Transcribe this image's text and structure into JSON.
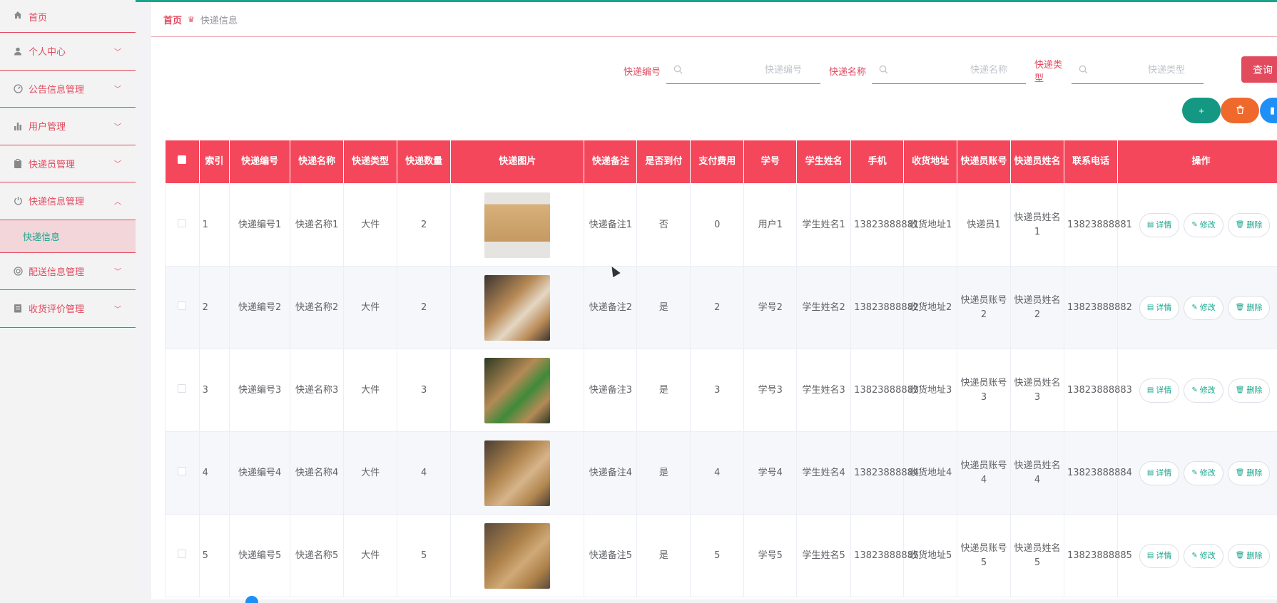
{
  "sidebar": {
    "items": [
      {
        "label": "首页",
        "icon": "home-icon",
        "name": "sidebar-item-home"
      },
      {
        "label": "个人中心",
        "icon": "user-icon",
        "name": "sidebar-item-personal"
      },
      {
        "label": "公告信息管理",
        "icon": "gauge-icon",
        "name": "sidebar-item-notice"
      },
      {
        "label": "用户管理",
        "icon": "bar-chart-icon",
        "name": "sidebar-item-users"
      },
      {
        "label": "快递员管理",
        "icon": "clipboard-icon",
        "name": "sidebar-item-courier"
      },
      {
        "label": "快递信息管理",
        "icon": "power-icon",
        "name": "sidebar-item-express"
      },
      {
        "label": "快递信息",
        "name": "sidebar-subitem-express-info"
      },
      {
        "label": "配送信息管理",
        "icon": "lifebuoy-icon",
        "name": "sidebar-item-delivery"
      },
      {
        "label": "收货评价管理",
        "icon": "document-icon",
        "name": "sidebar-item-review"
      }
    ]
  },
  "breadcrumb": {
    "home": "首页",
    "current": "快递信息"
  },
  "search": {
    "f1_label": "快递编号",
    "f1_placeholder": "快递编号",
    "f2_label": "快递名称",
    "f2_placeholder": "快递名称",
    "f3_label": "快递类型",
    "f3_placeholder": "快递类型",
    "query": "查询"
  },
  "actions": {
    "add": "+",
    "delete": "🗑",
    "chart": "▮"
  },
  "table": {
    "headers": [
      "索引",
      "快递编号",
      "快递名称",
      "快递类型",
      "快递数量",
      "快递图片",
      "快递备注",
      "是否到付",
      "支付费用",
      "学号",
      "学生姓名",
      "手机",
      "收货地址",
      "快递员账号",
      "快递员姓名",
      "联系电话",
      "操作"
    ],
    "ops": {
      "detail": "详情",
      "edit": "修改",
      "delete": "删除"
    },
    "rows": [
      [
        "1",
        "快递编号1",
        "快递名称1",
        "大件",
        "2",
        "",
        "快递备注1",
        "否",
        "0",
        "用户1",
        "学生姓名1",
        "13823888881",
        "收货地址1",
        "快递员1",
        "快递员姓名1",
        "13823888881"
      ],
      [
        "2",
        "快递编号2",
        "快递名称2",
        "大件",
        "2",
        "",
        "快递备注2",
        "是",
        "2",
        "学号2",
        "学生姓名2",
        "13823888882",
        "收货地址2",
        "快递员账号2",
        "快递员姓名2",
        "13823888882"
      ],
      [
        "3",
        "快递编号3",
        "快递名称3",
        "大件",
        "3",
        "",
        "快递备注3",
        "是",
        "3",
        "学号3",
        "学生姓名3",
        "13823888883",
        "收货地址3",
        "快递员账号3",
        "快递员姓名3",
        "13823888883"
      ],
      [
        "4",
        "快递编号4",
        "快递名称4",
        "大件",
        "4",
        "",
        "快递备注4",
        "是",
        "4",
        "学号4",
        "学生姓名4",
        "13823888884",
        "收货地址4",
        "快递员账号4",
        "快递员姓名4",
        "13823888884"
      ],
      [
        "5",
        "快递编号5",
        "快递名称5",
        "大件",
        "5",
        "",
        "快递备注5",
        "是",
        "5",
        "学号5",
        "学生姓名5",
        "13823888885",
        "收货地址5",
        "快递员账号5",
        "快递员姓名5",
        "13823888885"
      ]
    ]
  },
  "colors": {
    "accent": "#e24a5e",
    "header_bg": "#f5475c",
    "green": "#18a58c",
    "orange": "#f0692c",
    "blue": "#1e8ff7"
  }
}
